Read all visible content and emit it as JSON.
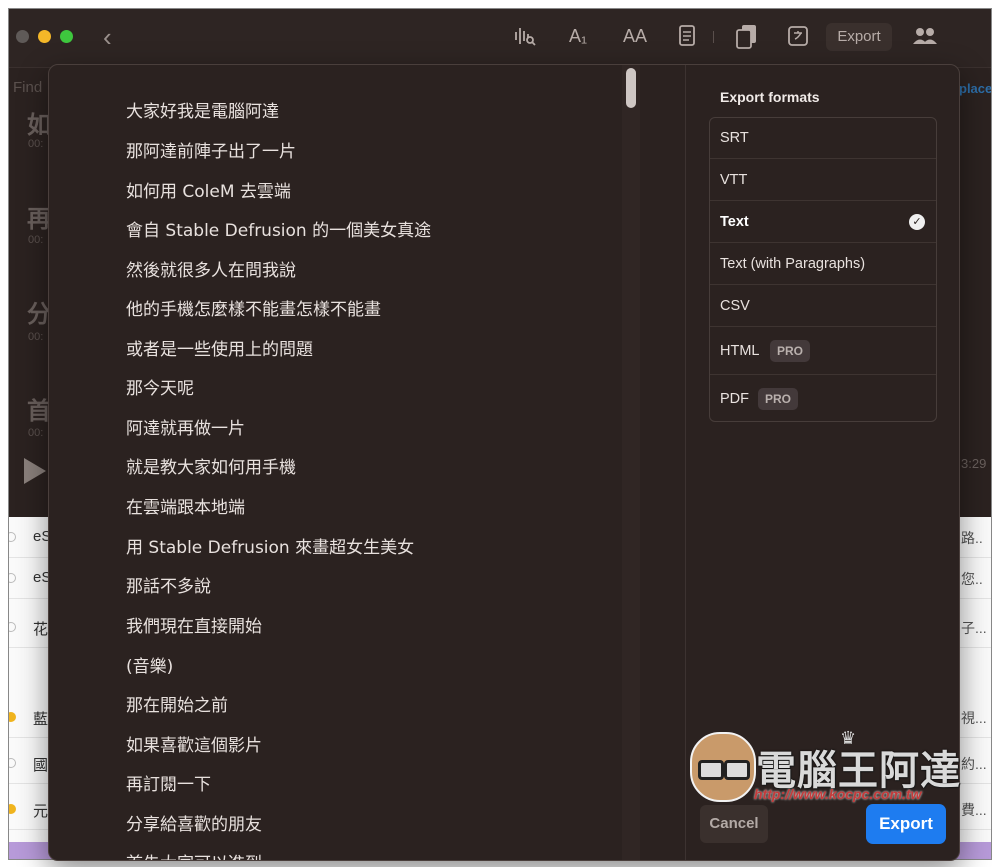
{
  "toolbar": {
    "back": "‹",
    "icons": {
      "waveform": "waveform-icon",
      "font_size_small": "A₁",
      "font_size_large": "AA",
      "document": "document-icon",
      "copy": "copy-icon",
      "translate": "translate-icon",
      "people": "people-icon"
    },
    "export_label": "Export"
  },
  "background": {
    "find_label": "Find",
    "replace_label": "place",
    "blocks": [
      {
        "char": "如",
        "time": "00:"
      },
      {
        "char": "再",
        "time": "00:"
      },
      {
        "char": "分",
        "time": "00:"
      },
      {
        "char": "首",
        "time": "00:"
      }
    ],
    "time_right": "3:29",
    "list_rows": [
      {
        "left": "eS",
        "right": "路..",
        "dot": false
      },
      {
        "left": "eS",
        "right": "您..",
        "dot": false
      },
      {
        "left": "花",
        "right": "子...",
        "dot": false
      },
      {
        "left": "藍",
        "right": "視...",
        "dot": true
      },
      {
        "left": "國",
        "right": "約...",
        "dot": false
      },
      {
        "left": "元",
        "right": "費...",
        "dot": true
      }
    ]
  },
  "transcript": {
    "lines": [
      "大家好我是電腦阿達",
      "那阿達前陣子出了一片",
      "如何用 ColeM 去雲端",
      "會自 Stable Defrusion 的一個美女真途",
      "然後就很多人在問我說",
      "他的手機怎麼樣不能畫怎樣不能畫",
      "或者是一些使用上的問題",
      "那今天呢",
      "阿達就再做一片",
      "就是教大家如何用手機",
      "在雲端跟本地端",
      "用 Stable Defrusion 來畫超女生美女",
      "那話不多說",
      "我們現在直接開始",
      "(音樂)",
      "那在開始之前",
      "如果喜歡這個影片",
      "再訂閱一下",
      "分享給喜歡的朋友",
      "首先大家可以進到"
    ]
  },
  "export_panel": {
    "title": "Export formats",
    "formats": [
      {
        "label": "SRT",
        "selected": false,
        "pro": false
      },
      {
        "label": "VTT",
        "selected": false,
        "pro": false
      },
      {
        "label": "Text",
        "selected": true,
        "pro": false
      },
      {
        "label": "Text (with Paragraphs)",
        "selected": false,
        "pro": false
      },
      {
        "label": "CSV",
        "selected": false,
        "pro": false
      },
      {
        "label": "HTML",
        "selected": false,
        "pro": true
      },
      {
        "label": "PDF",
        "selected": false,
        "pro": true
      }
    ],
    "pro_badge": "PRO",
    "check_glyph": "✓",
    "cancel_label": "Cancel",
    "export_label": "Export"
  },
  "watermark": {
    "brand": "電腦王阿達",
    "url": "http://www.kocpc.com.tw"
  },
  "colors": {
    "window_bg": "#2b2220",
    "accent": "#1e7cf0",
    "traffic_yellow": "#f4b728",
    "traffic_green": "#3ec73e"
  }
}
